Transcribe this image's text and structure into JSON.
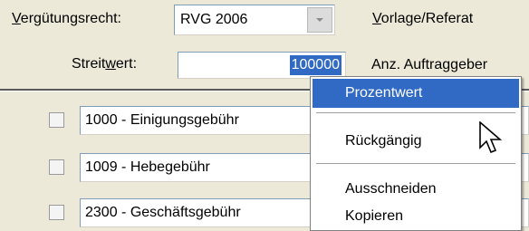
{
  "form": {
    "verguetungsrecht_label_underlined": "V",
    "verguetungsrecht_label_rest": "ergütungsrecht:",
    "verguetungsrecht_value": "RVG 2006",
    "vorlage_label_underlined": "V",
    "vorlage_label_rest": "orlage/Referat",
    "streitwert_label_pre": "Streit",
    "streitwert_label_underlined": "w",
    "streitwert_label_post": "ert:",
    "streitwert_value": "100000",
    "anz_auftraggeber_label": "Anz. Auftraggeber"
  },
  "fees": [
    {
      "label": "1000 - Einigungsgebühr",
      "checked": false
    },
    {
      "label": "1009 - Hebegebühr",
      "checked": false
    },
    {
      "label": "2300 - Geschäftsgebühr",
      "checked": false
    }
  ],
  "context_menu": {
    "items": [
      {
        "label": "Prozentwert",
        "highlighted": true
      },
      {
        "label": "Rückgängig",
        "highlighted": false
      },
      {
        "label": "Ausschneiden",
        "highlighted": false
      },
      {
        "label": "Kopieren",
        "highlighted": false
      }
    ]
  },
  "colors": {
    "window_bg": "#ece9d8",
    "selection": "#316ac5"
  },
  "icons": {
    "combo_dropdown": "chevron-down-icon",
    "cursor": "mouse-pointer-icon"
  }
}
